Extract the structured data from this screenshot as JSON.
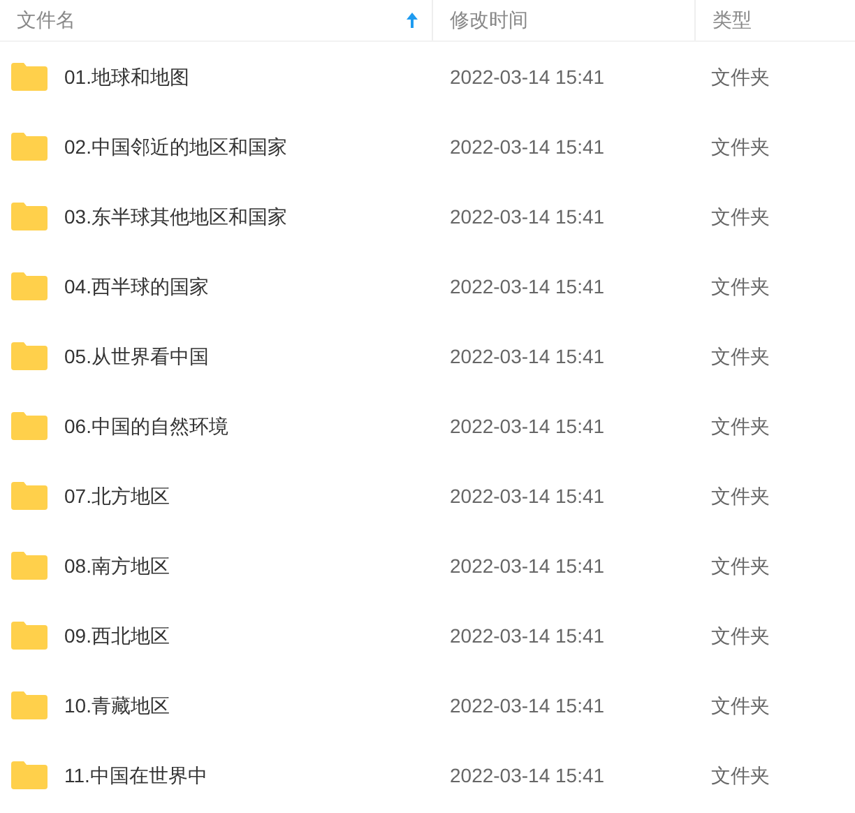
{
  "columns": [
    {
      "label": "文件名",
      "sorted": true
    },
    {
      "label": "修改时间",
      "sorted": false
    },
    {
      "label": "类型",
      "sorted": false
    }
  ],
  "rows": [
    {
      "name": "01.地球和地图",
      "modified": "2022-03-14 15:41",
      "type": "文件夹"
    },
    {
      "name": "02.中国邻近的地区和国家",
      "modified": "2022-03-14 15:41",
      "type": "文件夹"
    },
    {
      "name": "03.东半球其他地区和国家",
      "modified": "2022-03-14 15:41",
      "type": "文件夹"
    },
    {
      "name": "04.西半球的国家",
      "modified": "2022-03-14 15:41",
      "type": "文件夹"
    },
    {
      "name": "05.从世界看中国",
      "modified": "2022-03-14 15:41",
      "type": "文件夹"
    },
    {
      "name": "06.中国的自然环境",
      "modified": "2022-03-14 15:41",
      "type": "文件夹"
    },
    {
      "name": "07.北方地区",
      "modified": "2022-03-14 15:41",
      "type": "文件夹"
    },
    {
      "name": "08.南方地区",
      "modified": "2022-03-14 15:41",
      "type": "文件夹"
    },
    {
      "name": "09.西北地区",
      "modified": "2022-03-14 15:41",
      "type": "文件夹"
    },
    {
      "name": "10.青藏地区",
      "modified": "2022-03-14 15:41",
      "type": "文件夹"
    },
    {
      "name": "11.中国在世界中",
      "modified": "2022-03-14 15:41",
      "type": "文件夹"
    }
  ]
}
